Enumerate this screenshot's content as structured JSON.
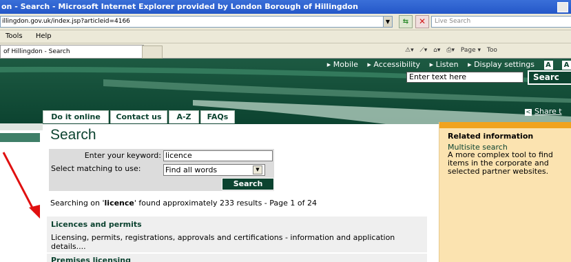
{
  "browser": {
    "title": "on - Search - Microsoft Internet Explorer provided by London Borough of Hillingdon",
    "url": "illingdon.gov.uk/index.jsp?articleid=4166",
    "live_search_placeholder": "Live Search",
    "menu": [
      "Tools",
      "Help"
    ],
    "tab_title": "of Hillingdon - Search",
    "command_bar": [
      "Page ▾",
      "Too"
    ]
  },
  "header": {
    "util_links": [
      "▸ Mobile",
      "▸ Accessibility",
      "▸ Listen",
      "▸ Display settings"
    ],
    "font_small": "A",
    "font_large": "A",
    "site_search_value": "Enter text here",
    "site_search_button": "Searc",
    "share_label": "Share t"
  },
  "nav_tabs": [
    "Do it online",
    "Contact us",
    "A-Z",
    "FAQs"
  ],
  "page": {
    "title": "Search"
  },
  "search_form": {
    "keyword_label": "Enter your keyword:",
    "keyword_value": "licence",
    "matching_label": "Select matching to use:",
    "matching_value": "Find all words",
    "button": "Search"
  },
  "results_summary": {
    "prefix": "Searching on '",
    "term": "licence",
    "suffix": "' found approximately 233 results - Page 1 of 24"
  },
  "results": [
    {
      "title": "Licences and permits",
      "description": "Licensing, permits, registrations, approvals and certifications - information and application details...."
    },
    {
      "title": "Premises licensing",
      "description": ""
    }
  ],
  "related": {
    "heading": "Related information",
    "link": "Multisite search",
    "description": "A more complex tool to find items in the corporate and selected partner websites."
  },
  "colors": {
    "brand_green": "#0c4330",
    "accent_orange": "#f0a31e",
    "sidebar_bg": "#fbe3b0",
    "annotation_arrow": "#e01010"
  }
}
